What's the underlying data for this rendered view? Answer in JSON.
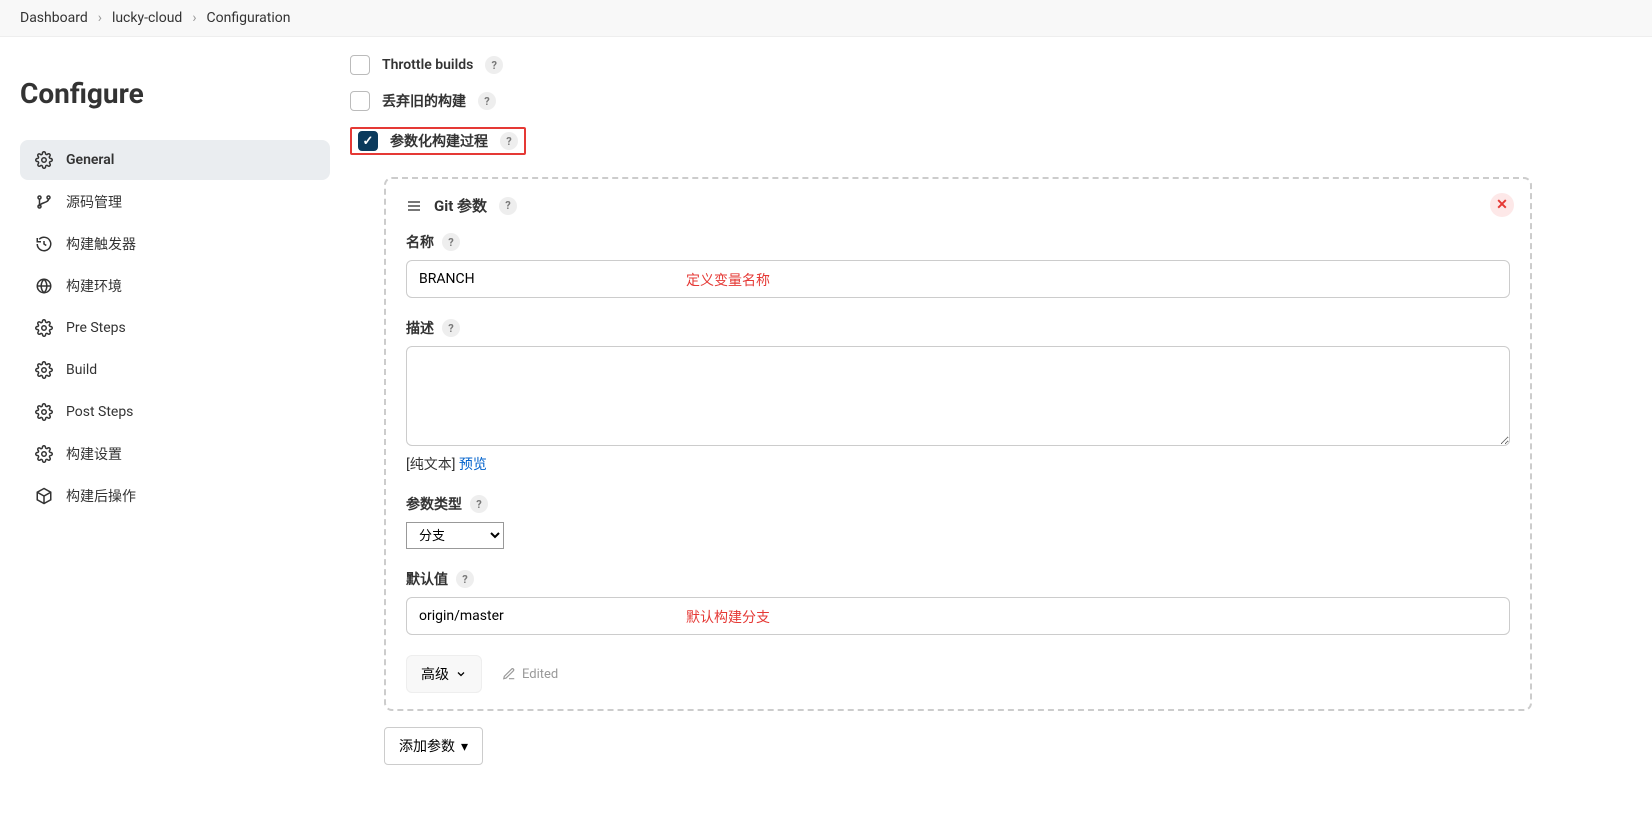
{
  "breadcrumb": {
    "items": [
      "Dashboard",
      "lucky-cloud",
      "Configuration"
    ]
  },
  "page_title": "Configure",
  "sidebar": {
    "items": [
      {
        "label": "General",
        "icon": "gear"
      },
      {
        "label": "源码管理",
        "icon": "branch"
      },
      {
        "label": "构建触发器",
        "icon": "clock"
      },
      {
        "label": "构建环境",
        "icon": "globe"
      },
      {
        "label": "Pre Steps",
        "icon": "gear"
      },
      {
        "label": "Build",
        "icon": "gear"
      },
      {
        "label": "Post Steps",
        "icon": "gear"
      },
      {
        "label": "构建设置",
        "icon": "gear"
      },
      {
        "label": "构建后操作",
        "icon": "box"
      }
    ]
  },
  "options": {
    "throttle_label": "Throttle builds",
    "discard_label": "丢弃旧的构建",
    "parameterize_label": "参数化构建过程"
  },
  "panel": {
    "title": "Git 参数",
    "name_label": "名称",
    "name_value": "BRANCH",
    "name_annotation": "定义变量名称",
    "desc_label": "描述",
    "desc_value": "",
    "plain_text_prefix": "[纯文本] ",
    "preview_label": "预览",
    "param_type_label": "参数类型",
    "param_type_value": "分支",
    "default_label": "默认值",
    "default_value": "origin/master",
    "default_annotation": "默认构建分支",
    "advanced_label": "高级",
    "edited_label": "Edited"
  },
  "add_param_label": "添加参数"
}
